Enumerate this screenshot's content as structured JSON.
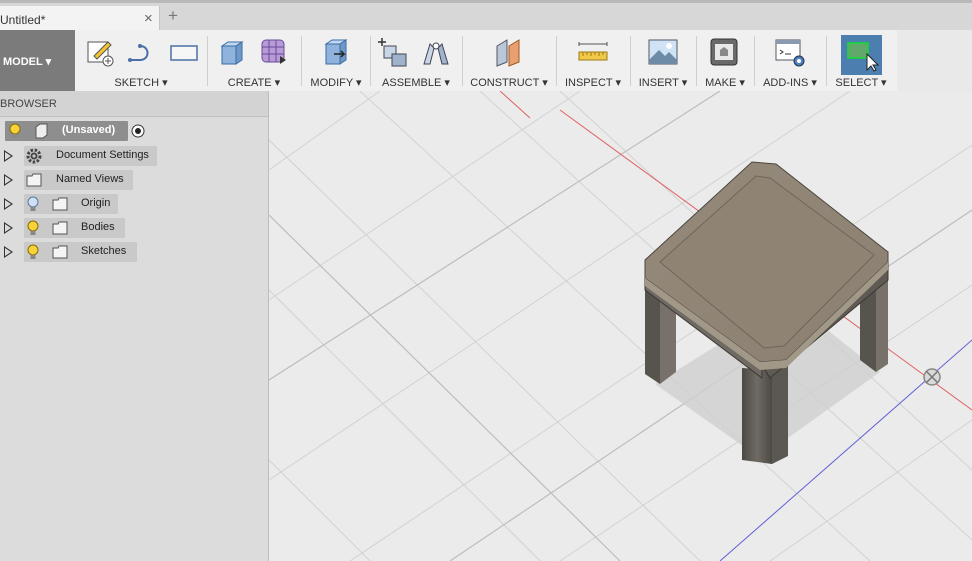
{
  "tab": {
    "title": "Untitled*",
    "close": "×",
    "new": "+"
  },
  "workspace": {
    "label": "MODEL ▾"
  },
  "toolbar": {
    "sketch": "SKETCH ▾",
    "create": "CREATE ▾",
    "modify": "MODIFY ▾",
    "assemble": "ASSEMBLE ▾",
    "construct": "CONSTRUCT ▾",
    "inspect": "INSPECT ▾",
    "insert": "INSERT ▾",
    "make": "MAKE ▾",
    "addins": "ADD-INS ▾",
    "select": "SELECT ▾"
  },
  "browser": {
    "title": "BROWSER",
    "root": "(Unsaved)",
    "items": [
      {
        "label": "Document Settings",
        "icon": "gear-icon"
      },
      {
        "label": "Named Views",
        "icon": "folder-icon"
      },
      {
        "label": "Origin",
        "icon": "folder-icon",
        "light": "off"
      },
      {
        "label": "Bodies",
        "icon": "folder-icon",
        "light": "on"
      },
      {
        "label": "Sketches",
        "icon": "folder-icon",
        "light": "on"
      }
    ]
  },
  "colors": {
    "accent_select": "#4c7fb0",
    "body_top": "#8c8274",
    "body_side": "#6b665e",
    "grid": "#d4d4d4",
    "axis_red": "#e05252",
    "axis_blue": "#5a5ad6"
  }
}
